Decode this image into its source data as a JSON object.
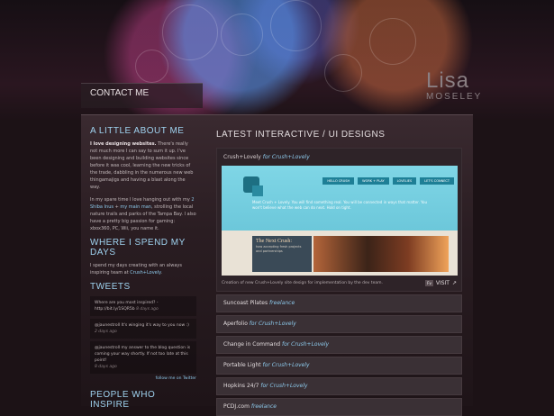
{
  "nav": {
    "contact_label": "CONTACT ME"
  },
  "logo": {
    "line1": "Lisa",
    "line2": "MOSELEY"
  },
  "sidebar": {
    "about_title": "A LITTLE ABOUT ME",
    "about_lead": "I love designing websites.",
    "about_p1": " There's really not much more I can say to sum it up. I've been designing and building websites since before it was cool, learning the new tricks of the trade, dabbling in the numerous new web thingamajigs and having a blast along the way.",
    "about_p2a": "In my spare time I love hanging out with my ",
    "about_p2_link1": "2 Shiba Inus",
    "about_p2b": " + ",
    "about_p2_link2": "my main man",
    "about_p2c": ", strolling the local nature trails and parks of the Tampa Bay. I also have a pretty big passion for gaming: xbox360, PC, Wii, you name it.",
    "days_title": "WHERE I SPEND MY DAYS",
    "days_text": "I spend my days creating with an always inspiring team at ",
    "days_link": "Crush+Lovely",
    "days_end": ".",
    "tweets_title": "TWEETS",
    "tweets": [
      {
        "text": "Where are you most inspired? - http://bit.ly/1SQR5b",
        "meta": "8 days ago"
      },
      {
        "text": "@jaunestroll It's winging it's way to you now :)",
        "meta": "2 days ago"
      },
      {
        "text": "@jaunestroll my answer to the blog question is coming your way shortly. If not too late at this point!",
        "meta": "8 days ago"
      }
    ],
    "follow": "follow me on Twitter",
    "people_title": "PEOPLE WHO INSPIRE"
  },
  "main": {
    "title": "LATEST INTERACTIVE / UI DESIGNS",
    "featured": {
      "name": "Crush+Lovely",
      "for": "for Crush+Lovely",
      "nav": [
        "HELLO CRUSH",
        "WORK + PLAY",
        "LOVELIES",
        "LET'S CONNECT"
      ],
      "shot_text": "Meet Crush + Lovely. You will find something real. You will be connected in ways that matter. You won't believe what the web can do next. Hold on tight.",
      "next_title": "The Next Crush:",
      "next_sub": "how accepting fresh projects and partnerships",
      "caption": "Creation of new Crush+Lovely site design for implementation by the dev team.",
      "badge": "Fv",
      "visit": "VISIT"
    },
    "projects": [
      {
        "name": "Suncoast Pilates",
        "for": "freelance"
      },
      {
        "name": "Aperfolio",
        "for": "for Crush+Lovely"
      },
      {
        "name": "Change in Command",
        "for": "for Crush+Lovely"
      },
      {
        "name": "Portable Light",
        "for": "for Crush+Lovely"
      },
      {
        "name": "Hopkins 24/7",
        "for": "for Crush+Lovely"
      },
      {
        "name": "PCDJ.com",
        "for": "freelance"
      }
    ]
  }
}
